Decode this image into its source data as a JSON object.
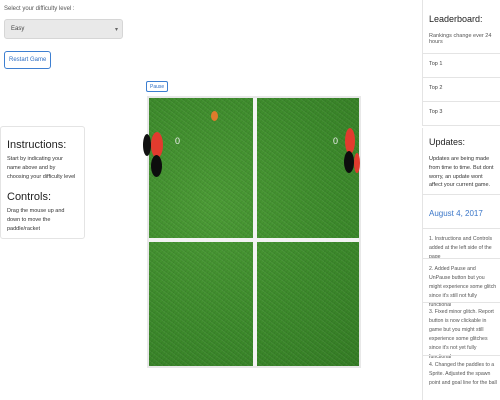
{
  "difficulty": {
    "label": "Select your difficulty level :",
    "selected": "Easy"
  },
  "restart_label": "Restart Game",
  "pause_label": "Pause",
  "instructions": {
    "title": "Instructions:",
    "text": "Start by indicating your name above and by choosing your difficulty level",
    "controls_title": "Controls:",
    "controls_text": "Drag the mouse up and down to move the paddle/racket"
  },
  "game": {
    "score_left": "0",
    "score_right": "0",
    "colors": {
      "field": "#3f8f2e",
      "lines": "#f3f3f3",
      "ball": "#e07b2c",
      "paddle_red": "#e23b2e",
      "paddle_black": "#0d0d0d"
    }
  },
  "leaderboard": {
    "title": "Leaderboard:",
    "note": "Rankings change ever 24 hours",
    "rows": [
      "Top 1",
      "Top 2",
      "Top 3"
    ]
  },
  "updates": {
    "title": "Updates:",
    "description": "Updates are being made from time to time. But dont worry, an update wont affect your current game.",
    "date": "August 4, 2017",
    "items": [
      "1. Instructions and Controls added at the left side of the page",
      "2. Added Pause and UnPause button but you might experience some glitch since it's still not fully functional",
      "3. Fixed minor glitch. Report button is now clickable in game but you might still experience some glitches since it's not yet fully functional",
      "4. Changed the paddles to a Sprite. Adjusted the spawn point and goal line for the ball"
    ]
  }
}
